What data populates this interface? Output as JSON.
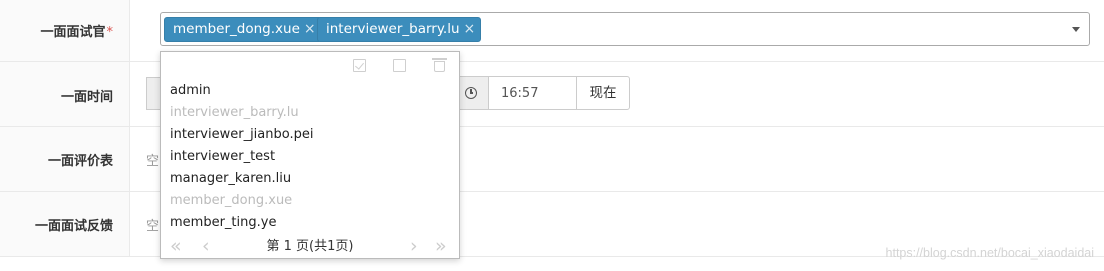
{
  "form": {
    "interviewer_label": "一面面试官",
    "required_mark": "*",
    "selected_tags": [
      {
        "label": "member_dong.xue",
        "remove": "×"
      },
      {
        "label": "interviewer_barry.lu",
        "remove": "×"
      }
    ],
    "time_label": "一面时间",
    "time_value": "16:57",
    "now_button": "现在",
    "evaluation_label": "一面评价表",
    "evaluation_value": "空",
    "feedback_label": "一面面试反馈",
    "feedback_value": "空"
  },
  "dropdown": {
    "toolbar_icons": [
      "check-all-icon",
      "uncheck-icon",
      "clear-icon"
    ],
    "options": [
      {
        "label": "admin",
        "disabled": false
      },
      {
        "label": "interviewer_barry.lu",
        "disabled": true
      },
      {
        "label": "interviewer_jianbo.pei",
        "disabled": false
      },
      {
        "label": "interviewer_test",
        "disabled": false
      },
      {
        "label": "manager_karen.liu",
        "disabled": false
      },
      {
        "label": "member_dong.xue",
        "disabled": true
      },
      {
        "label": "member_ting.ye",
        "disabled": false
      }
    ],
    "pager": {
      "first": "«",
      "prev": "‹",
      "next": "›",
      "last": "»",
      "info": "第 1 页(共1页)"
    }
  },
  "watermark": "https://blog.csdn.net/bocai_xiaodaidai",
  "colors": {
    "tag_bg": "#3c8dbc",
    "required": "#d9534f",
    "disabled_option": "#bbbbbb"
  }
}
